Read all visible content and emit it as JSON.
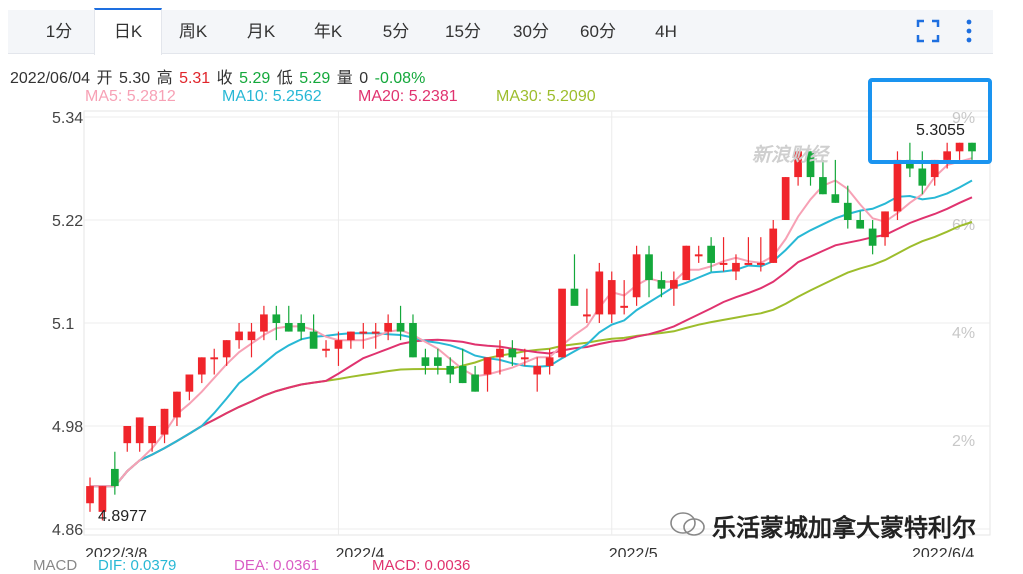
{
  "tabs": [
    {
      "label": "1分",
      "active": false
    },
    {
      "label": "日K",
      "active": true
    },
    {
      "label": "周K",
      "active": false
    },
    {
      "label": "月K",
      "active": false
    },
    {
      "label": "年K",
      "active": false
    },
    {
      "label": "5分",
      "active": false
    },
    {
      "label": "15分",
      "active": false
    },
    {
      "label": "30分",
      "active": false
    },
    {
      "label": "60分",
      "active": false
    },
    {
      "label": "4H",
      "active": false
    }
  ],
  "tools": {
    "fullscreen_icon": "fullscreen-icon",
    "more_icon": "more-vertical-icon"
  },
  "quote": {
    "date": "2022/06/04",
    "open_label": "开",
    "open": "5.30",
    "high_label": "高",
    "high": "5.31",
    "close_label": "收",
    "close": "5.29",
    "low_label": "低",
    "low": "5.29",
    "volume_label": "量",
    "volume": "0",
    "change": "-0.08%"
  },
  "ma_labels": {
    "ma5": "MA5: 5.2812",
    "ma10": "MA10: 5.2562",
    "ma20": "MA20: 5.2381",
    "ma30": "MA30: 5.2090"
  },
  "macd_labels": {
    "name": "MACD",
    "dif": "DIF: 0.0379",
    "dea": "DEA: 0.0361",
    "macd": "MACD: 0.0036"
  },
  "watermark": {
    "site": "新浪财经",
    "account": "乐活蒙城加拿大蒙特利尔"
  },
  "colors": {
    "up": "#f0252b",
    "down": "#14a83b",
    "ma5": "#f7a1b5",
    "ma10": "#28b8d5",
    "ma20": "#e0336f",
    "ma30": "#9dbd2c",
    "accent": "#1e6fe0"
  },
  "chart_data": {
    "type": "candlestick",
    "y_ticks": [
      "5.34",
      "5.22",
      "5.1",
      "4.98",
      "4.86"
    ],
    "y_right_ticks": [
      "9%",
      "6%",
      "4%",
      "2%"
    ],
    "x_ticks": [
      "2022/3/8",
      "2022/4",
      "2022/5",
      "2022/6/4"
    ],
    "ylim": [
      4.86,
      5.34
    ],
    "grid": true,
    "min_label": "4.8977",
    "max_label": "5.3055",
    "candles": [
      [
        4.89,
        4.92,
        4.88,
        4.91
      ],
      [
        4.88,
        4.91,
        4.87,
        4.91
      ],
      [
        4.93,
        4.95,
        4.9,
        4.91
      ],
      [
        4.96,
        4.98,
        4.95,
        4.98
      ],
      [
        4.96,
        4.99,
        4.95,
        4.99
      ],
      [
        4.96,
        4.97,
        4.95,
        4.98
      ],
      [
        4.97,
        5.0,
        4.96,
        5.0
      ],
      [
        4.99,
        5.02,
        4.98,
        5.02
      ],
      [
        5.02,
        5.04,
        5.01,
        5.04
      ],
      [
        5.04,
        5.06,
        5.03,
        5.06
      ],
      [
        5.06,
        5.07,
        5.04,
        5.06
      ],
      [
        5.06,
        5.08,
        5.05,
        5.08
      ],
      [
        5.08,
        5.1,
        5.07,
        5.09
      ],
      [
        5.08,
        5.1,
        5.06,
        5.09
      ],
      [
        5.09,
        5.12,
        5.08,
        5.11
      ],
      [
        5.11,
        5.12,
        5.08,
        5.1
      ],
      [
        5.1,
        5.12,
        5.09,
        5.09
      ],
      [
        5.1,
        5.11,
        5.08,
        5.09
      ],
      [
        5.09,
        5.11,
        5.08,
        5.07
      ],
      [
        5.07,
        5.08,
        5.06,
        5.07
      ],
      [
        5.07,
        5.09,
        5.05,
        5.08
      ],
      [
        5.08,
        5.09,
        5.07,
        5.09
      ],
      [
        5.09,
        5.1,
        5.07,
        5.09
      ],
      [
        5.09,
        5.1,
        5.07,
        5.09
      ],
      [
        5.09,
        5.11,
        5.08,
        5.1
      ],
      [
        5.1,
        5.12,
        5.08,
        5.09
      ],
      [
        5.1,
        5.11,
        5.06,
        5.06
      ],
      [
        5.06,
        5.07,
        5.04,
        5.05
      ],
      [
        5.06,
        5.07,
        5.04,
        5.05
      ],
      [
        5.05,
        5.06,
        5.03,
        5.04
      ],
      [
        5.05,
        5.07,
        5.03,
        5.03
      ],
      [
        5.04,
        5.05,
        5.02,
        5.02
      ],
      [
        5.04,
        5.06,
        5.02,
        5.06
      ],
      [
        5.06,
        5.08,
        5.04,
        5.07
      ],
      [
        5.07,
        5.08,
        5.05,
        5.06
      ],
      [
        5.06,
        5.07,
        5.05,
        5.06
      ],
      [
        5.04,
        5.06,
        5.02,
        5.05
      ],
      [
        5.05,
        5.07,
        5.04,
        5.06
      ],
      [
        5.06,
        5.1,
        5.06,
        5.14
      ],
      [
        5.14,
        5.18,
        5.14,
        5.12
      ],
      [
        5.11,
        5.14,
        5.1,
        5.11
      ],
      [
        5.11,
        5.17,
        5.1,
        5.16
      ],
      [
        5.11,
        5.16,
        5.1,
        5.15
      ],
      [
        5.12,
        5.15,
        5.11,
        5.12
      ],
      [
        5.13,
        5.19,
        5.12,
        5.18
      ],
      [
        5.18,
        5.19,
        5.13,
        5.15
      ],
      [
        5.15,
        5.16,
        5.13,
        5.14
      ],
      [
        5.14,
        5.16,
        5.12,
        5.15
      ],
      [
        5.15,
        5.19,
        5.15,
        5.19
      ],
      [
        5.18,
        5.19,
        5.17,
        5.18
      ],
      [
        5.19,
        5.2,
        5.16,
        5.17
      ],
      [
        5.17,
        5.2,
        5.16,
        5.17
      ],
      [
        5.16,
        5.18,
        5.15,
        5.17
      ],
      [
        5.17,
        5.2,
        5.17,
        5.17
      ],
      [
        5.17,
        5.2,
        5.16,
        5.17
      ],
      [
        5.17,
        5.22,
        5.17,
        5.21
      ],
      [
        5.22,
        5.27,
        5.22,
        5.27
      ],
      [
        5.27,
        5.3,
        5.26,
        5.3
      ],
      [
        5.3,
        5.3,
        5.26,
        5.27
      ],
      [
        5.27,
        5.29,
        5.25,
        5.25
      ],
      [
        5.25,
        5.29,
        5.24,
        5.24
      ],
      [
        5.24,
        5.26,
        5.21,
        5.22
      ],
      [
        5.22,
        5.23,
        5.21,
        5.21
      ],
      [
        5.21,
        5.22,
        5.18,
        5.19
      ],
      [
        5.2,
        5.23,
        5.19,
        5.23
      ],
      [
        5.23,
        5.3,
        5.22,
        5.29
      ],
      [
        5.29,
        5.31,
        5.27,
        5.28
      ],
      [
        5.28,
        5.3,
        5.25,
        5.26
      ],
      [
        5.27,
        5.29,
        5.26,
        5.29
      ],
      [
        5.29,
        5.31,
        5.28,
        5.3
      ],
      [
        5.3,
        5.31,
        5.29,
        5.31
      ],
      [
        5.31,
        5.31,
        5.29,
        5.3
      ]
    ]
  }
}
